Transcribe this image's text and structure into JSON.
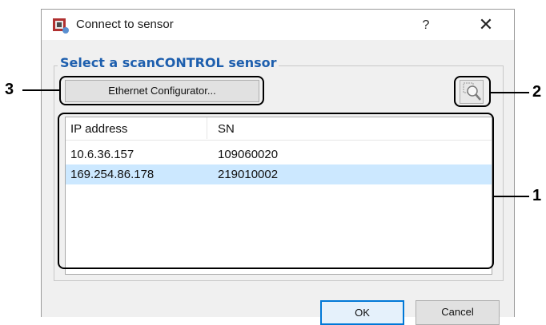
{
  "dialog": {
    "title": "Connect to sensor",
    "help_label": "?",
    "close_label": "✕"
  },
  "group": {
    "title": "Select a scanCONTROL sensor"
  },
  "buttons": {
    "ethernet_configurator": "Ethernet Configurator...",
    "ok": "OK",
    "cancel": "Cancel"
  },
  "sensor_list": {
    "columns": [
      "IP address",
      "SN"
    ],
    "rows": [
      {
        "ip": "10.6.36.157",
        "sn": "109060020",
        "selected": false
      },
      {
        "ip": "169.254.86.178",
        "sn": "219010002",
        "selected": true
      }
    ]
  },
  "annotations": {
    "callout_1": "1",
    "callout_2": "2",
    "callout_3": "3"
  },
  "colors": {
    "group_title": "#1e5fae",
    "selection": "#cce8ff",
    "default_button_border": "#0078d7"
  },
  "icons": {
    "app": "sensor-app-icon",
    "search": "magnifier-search-icon"
  }
}
